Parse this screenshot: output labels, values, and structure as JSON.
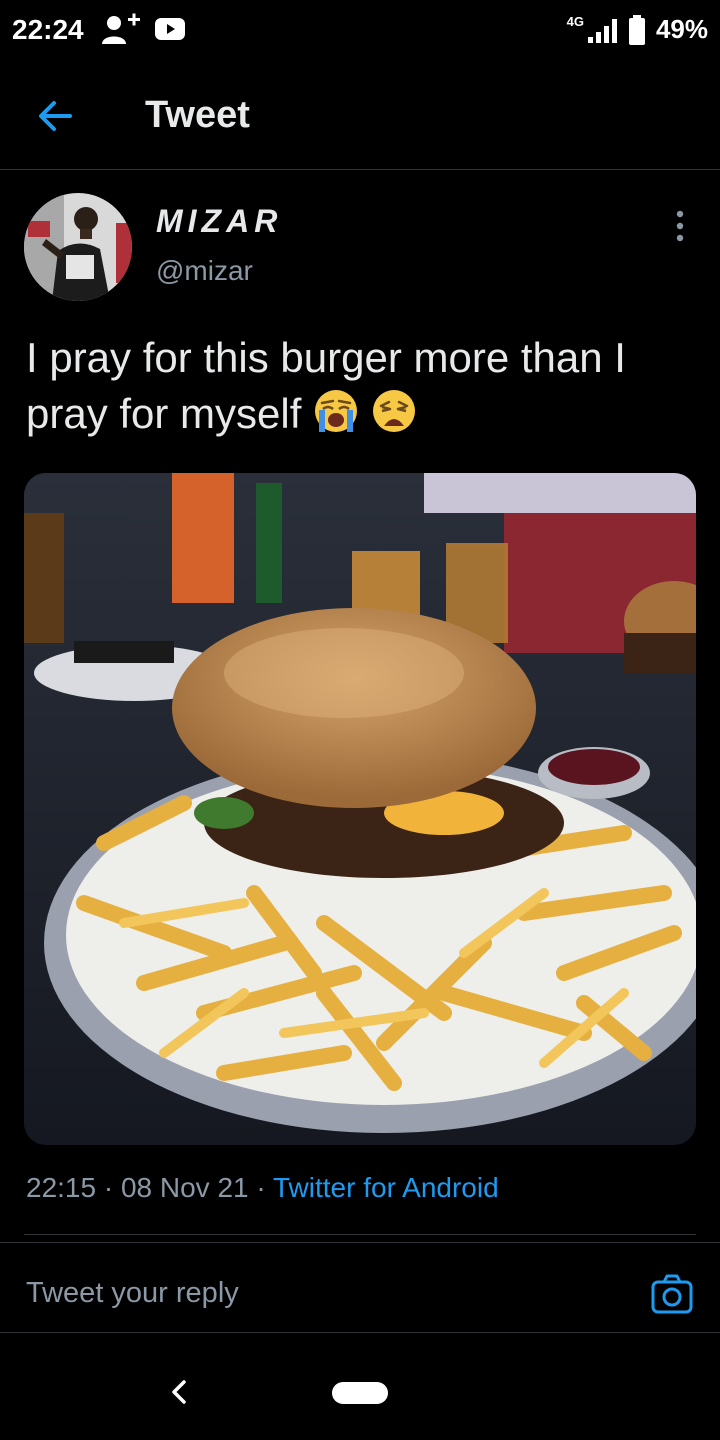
{
  "status_bar": {
    "time": "22:24",
    "network": "4G",
    "battery": "49%"
  },
  "header": {
    "title": "Tweet"
  },
  "tweet": {
    "display_name": "MIZAR",
    "handle": "@mizar",
    "text": "I pray for this burger more than I pray for myself",
    "emojis": [
      "loudly-crying-face-emoji",
      "weary-face-emoji"
    ],
    "time": "22:15",
    "date": "08 Nov 21",
    "source": "Twitter for Android",
    "separator": "·"
  },
  "reply": {
    "placeholder": "Tweet your reply"
  },
  "colors": {
    "accent": "#1d9bf0",
    "background": "#000000",
    "secondary_text": "#8b98a5",
    "divider": "#2f3336"
  }
}
